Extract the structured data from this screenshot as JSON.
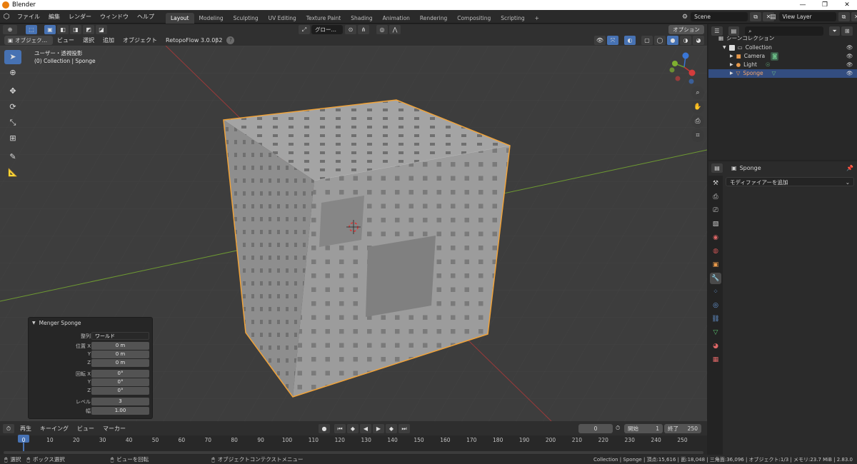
{
  "window": {
    "title": "Blender",
    "min": "—",
    "max": "❐",
    "close": "✕"
  },
  "menu": [
    "ファイル",
    "編集",
    "レンダー",
    "ウィンドウ",
    "ヘルプ"
  ],
  "workspaces": [
    "Layout",
    "Modeling",
    "Sculpting",
    "UV Editing",
    "Texture Paint",
    "Shading",
    "Animation",
    "Rendering",
    "Compositing",
    "Scripting"
  ],
  "add_workspace": "+",
  "scene": {
    "label": "Scene",
    "view_layer": "View Layer"
  },
  "viewport_header": {
    "mode": "オブジェク…",
    "menus": [
      "ビュー",
      "選択",
      "追加",
      "オブジェクト"
    ],
    "addon": "RetopoFlow 3.0.0β2",
    "help": "?",
    "orientation": "グロー…",
    "options": "オプション"
  },
  "viewport": {
    "view_name": "ユーザー・透視投影",
    "collection_line": "(0) Collection | Sponge",
    "gizmo": {
      "x": "X",
      "y": "Y",
      "z": "Z"
    }
  },
  "operator_panel": {
    "title": "Menger Sponge",
    "align_label": "整列",
    "align_value": "ワールド",
    "location_label": "位置 X",
    "loc_x": "0 m",
    "loc_y": "0 m",
    "loc_z": "0 m",
    "rotation_label": "回転 X",
    "rot_x": "0°",
    "rot_y": "0°",
    "rot_z": "0°",
    "y_label": "Y",
    "z_label": "Z",
    "level_label": "レベル",
    "level_value": "3",
    "width_label": "幅",
    "width_value": "1.00"
  },
  "outliner": {
    "title": "シーンコレクション",
    "items": [
      "Collection",
      "Camera",
      "Light",
      "Sponge"
    ]
  },
  "properties": {
    "object_name": "Sponge",
    "add_modifier": "モディファイアーを追加"
  },
  "timeline": {
    "menus": [
      "再生",
      "キーイング",
      "ビュー",
      "マーカー"
    ],
    "current_frame": "0",
    "start_label": "開始",
    "start": "1",
    "end_label": "終了",
    "end": "250",
    "ticks": [
      "0",
      "10",
      "20",
      "30",
      "40",
      "50",
      "60",
      "70",
      "80",
      "90",
      "100",
      "110",
      "120",
      "130",
      "140",
      "150",
      "160",
      "170",
      "180",
      "190",
      "200",
      "210",
      "220",
      "230",
      "240",
      "250"
    ]
  },
  "statusbar": {
    "select": "選択",
    "box_select": "ボックス選択",
    "rotate_view": "ビューを回転",
    "context_menu": "オブジェクトコンテクストメニュー",
    "stats": "Collection | Sponge | 頂点:15,616 | 面:18,048 | 三角面:36,096 | オブジェクト:1/3 | メモリ:23.7 MiB | 2.83.0"
  },
  "colors": {
    "accent": "#4772b3",
    "selection_outline": "#f0a33a",
    "mesh": "#9c9c9c"
  }
}
